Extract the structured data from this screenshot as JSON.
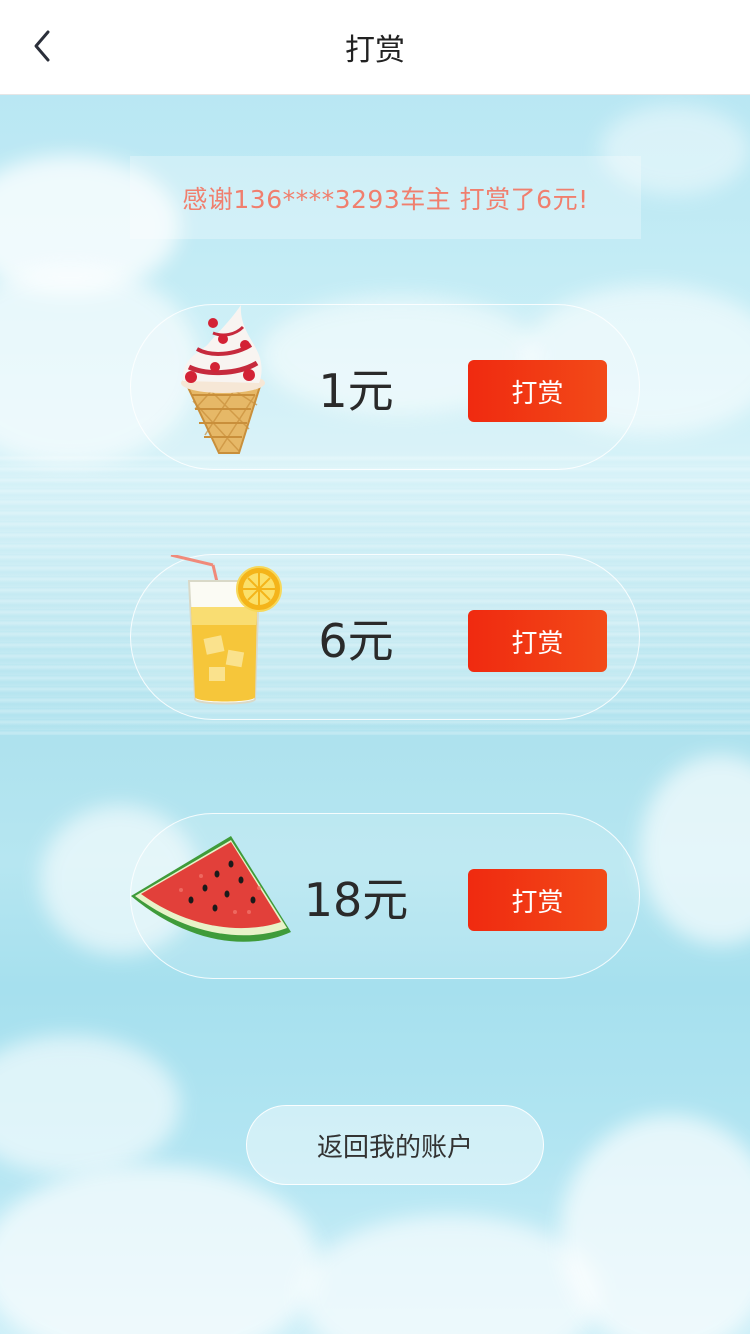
{
  "navbar": {
    "title": "打赏",
    "back_icon": "chevron-left-icon"
  },
  "notice": {
    "text": "感谢136****3293车主  打赏了6元!"
  },
  "tips": [
    {
      "amount": "1元",
      "button_label": "打赏",
      "icon": "ice-cream-icon"
    },
    {
      "amount": "6元",
      "button_label": "打赏",
      "icon": "lemonade-icon"
    },
    {
      "amount": "18元",
      "button_label": "打赏",
      "icon": "watermelon-icon"
    }
  ],
  "footer": {
    "back_account_label": "返回我的账户"
  },
  "colors": {
    "accent": "#f02a10",
    "notice_text": "#f07f6e"
  }
}
